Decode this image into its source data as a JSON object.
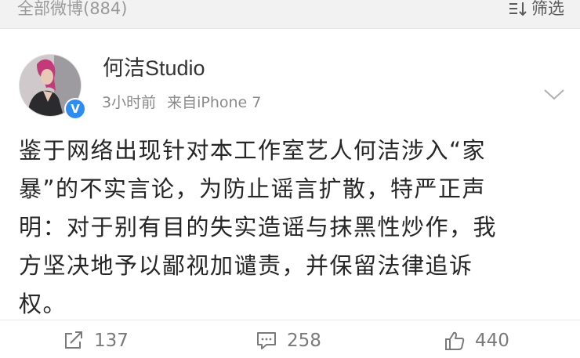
{
  "topbar": {
    "weibo_count_label": "全部微博(884)",
    "filter_label": "筛选",
    "filter_icon": "filter-icon"
  },
  "post": {
    "username": "何洁Studio",
    "time": "3小时前",
    "source": "来自iPhone 7",
    "verified_icon": "verified-icon",
    "verified_glyph": "V",
    "verified_color": "#2f8cf1",
    "more_icon": "chevron-down-icon",
    "text_lines": [
      "鉴于网络出现针对本工作室艺人何洁涉入“家",
      "暴”的不实言论，为防止谣言扩散，特严正声",
      "明：对于别有目的失实造谣与抹黑性炒作，我",
      "方坚决地予以鄙视加谴责，并保留法律追诉",
      "权。"
    ]
  },
  "actions": {
    "repost_count": "137",
    "comment_count": "258",
    "like_count": "440",
    "repost_icon": "repost-icon",
    "comment_icon": "comment-icon",
    "like_icon": "thumbs-up-icon"
  }
}
